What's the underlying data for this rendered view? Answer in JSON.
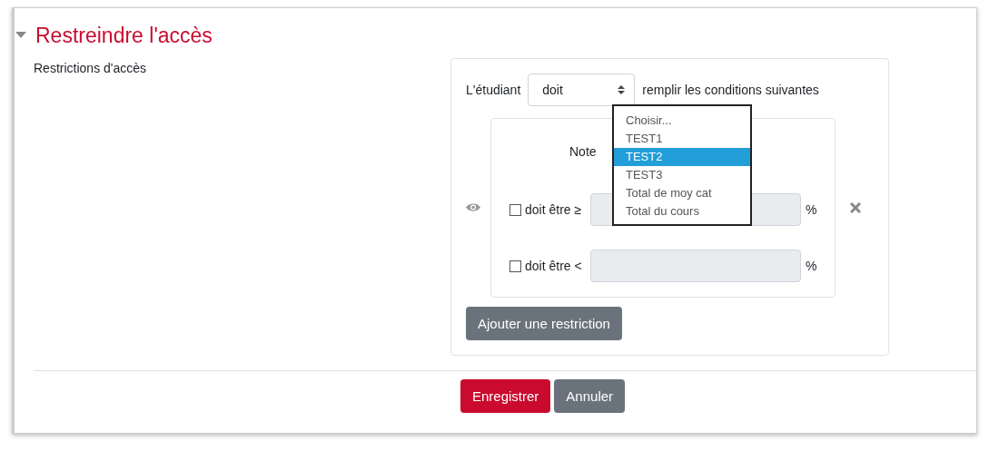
{
  "section": {
    "title": "Restreindre l'accès",
    "expanded": true
  },
  "field_label": "Restrictions d'accès",
  "rule": {
    "prefix": "L'étudiant",
    "mode_select": "doit",
    "suffix": "remplir les conditions suivantes"
  },
  "condition": {
    "label": "Note",
    "rows": [
      {
        "checked": false,
        "label": "doit être ≥",
        "unit": "%"
      },
      {
        "checked": false,
        "label": "doit être <",
        "unit": "%"
      }
    ]
  },
  "dropdown_options": [
    {
      "label": "Choisir...",
      "selected": false
    },
    {
      "label": "TEST1",
      "selected": false
    },
    {
      "label": "TEST2",
      "selected": true
    },
    {
      "label": "TEST3",
      "selected": false
    },
    {
      "label": "Total de moy cat",
      "selected": false
    },
    {
      "label": "Total du cours",
      "selected": false
    }
  ],
  "add_button": "Ajouter une restriction",
  "buttons": [
    {
      "label": "Enregistrer",
      "kind": "primary"
    },
    {
      "label": "Annuler",
      "kind": "secondary"
    }
  ]
}
